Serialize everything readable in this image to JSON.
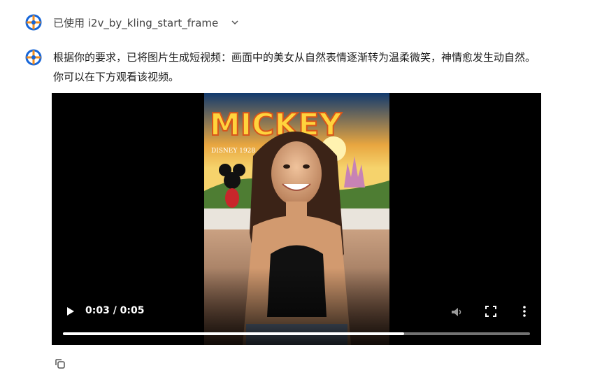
{
  "tool_call": {
    "label": "已使用 i2v_by_kling_start_frame",
    "icon": "chevron-down-icon"
  },
  "message": {
    "text": "根据你的要求，已将图片生成短视频：画面中的美女从自然表情逐渐转为温柔微笑，神情愈发生动自然。你可以在下方观看该视频。"
  },
  "video": {
    "poster_title": "MICKEY",
    "poster_sub": "DISNEY 1928",
    "time": "0:03 / 0:05",
    "progress": 0.73,
    "controls": {
      "play": "play-icon",
      "volume": "volume-icon",
      "fullscreen": "fullscreen-icon",
      "more": "more-options-icon"
    }
  },
  "actions": {
    "copy": "copy-icon"
  },
  "colors": {
    "avatar_blue": "#1565d8",
    "avatar_orange": "#f28c1c",
    "video_bg": "#000000"
  }
}
